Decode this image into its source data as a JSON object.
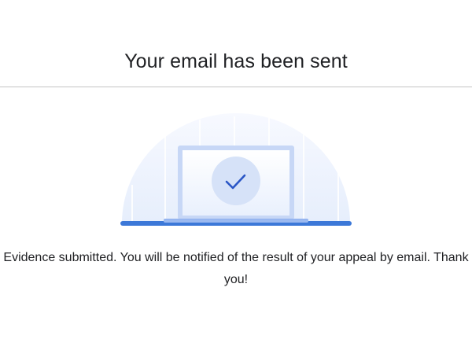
{
  "header": {
    "title": "Your email has been sent"
  },
  "illustration": {
    "icon": "laptop-checkmark-icon",
    "colors": {
      "accent": "#3c78d8",
      "dome": "#eef3fd",
      "laptop_frame": "#c5d6f7",
      "check_circle": "#d6e2f8",
      "check": "#2a56c6"
    }
  },
  "main": {
    "message": "Evidence submitted. You will be notified of the result of your appeal by email. Thank you!"
  }
}
